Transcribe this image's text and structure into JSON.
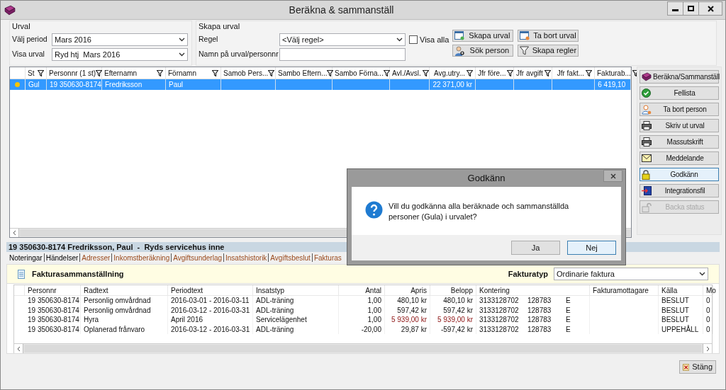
{
  "window": {
    "title": "Beräkna & sammanställ"
  },
  "urval": {
    "title": "Urval",
    "fields": [
      {
        "label": "Välj period",
        "value": "Mars 2016"
      },
      {
        "label": "Visa urval",
        "value": "Ryd htj  Mars 2016"
      }
    ]
  },
  "skapa_urval": {
    "title": "Skapa urval",
    "regel": {
      "label": "Regel",
      "value": "<Välj regel>"
    },
    "namn": {
      "label": "Namn på urval/personnr"
    },
    "visa_alla": {
      "label": "Visa alla",
      "checked": false
    },
    "buttons": [
      {
        "label": "Skapa urval"
      },
      {
        "label": "Ta bort urval"
      },
      {
        "label": "Sök person"
      },
      {
        "label": "Skapa regler"
      }
    ]
  },
  "grid": {
    "columns": [
      {
        "label": "St"
      },
      {
        "label": "Personnr (1 st)"
      },
      {
        "label": "Efternamn"
      },
      {
        "label": "Förnamn"
      },
      {
        "label": "Samob Pers..."
      },
      {
        "label": "Sambo Eftern..."
      },
      {
        "label": "Sambo Förna..."
      },
      {
        "label": "Avl./Avsl."
      },
      {
        "label": "Avg.utry..."
      },
      {
        "label": "Jfr före..."
      },
      {
        "label": "Jfr avgift"
      },
      {
        "label": "Jfr fakt..."
      },
      {
        "label": "Fakturab..."
      }
    ],
    "rows": [
      {
        "selected": true,
        "color": "#f5c400",
        "cells": [
          "Gul",
          "19 350630-8174",
          "Fredriksson",
          "Paul",
          "",
          "",
          "",
          "",
          "22 371,00 kr",
          "",
          "",
          "",
          "6 419,10 "
        ]
      }
    ]
  },
  "side_buttons": [
    {
      "label": "Beräkna/Sammanställ",
      "disabled": false,
      "focused": false
    },
    {
      "label": "Fellista",
      "disabled": false,
      "focused": false
    },
    {
      "label": "Ta bort person",
      "disabled": false,
      "focused": false
    },
    {
      "label": "Skriv ut urval",
      "disabled": false,
      "focused": false
    },
    {
      "label": "Massutskrift",
      "disabled": false,
      "focused": false
    },
    {
      "label": "Meddelande",
      "disabled": false,
      "focused": false
    },
    {
      "label": "Godkänn",
      "disabled": false,
      "focused": true
    },
    {
      "label": "Integrationsfil",
      "disabled": false,
      "focused": false
    },
    {
      "label": "Backa status",
      "disabled": true,
      "focused": false
    }
  ],
  "detail": {
    "header": "19 350630-8174 Fredriksson, Paul  -  Ryds servicehus inne",
    "tabs": [
      {
        "label": "Noteringar",
        "kind": "plain"
      },
      {
        "label": "Händelser",
        "kind": "plain"
      },
      {
        "label": "Adresser",
        "kind": "link"
      },
      {
        "label": "Inkomstberäkning",
        "kind": "link"
      },
      {
        "label": "Avgiftsunderlag",
        "kind": "link"
      },
      {
        "label": "Insatshistorik",
        "kind": "link"
      },
      {
        "label": "Avgiftsbeslut",
        "kind": "link"
      },
      {
        "label": "Fakturas",
        "kind": "link"
      }
    ],
    "panel": {
      "title": "Fakturasammanställning",
      "fakturatyp": {
        "label": "Fakturatyp",
        "value": "Ordinarie faktura"
      },
      "columns": [
        {
          "label": "Personnr"
        },
        {
          "label": "Radtext"
        },
        {
          "label": "Periodtext"
        },
        {
          "label": "Insatstyp"
        },
        {
          "label": "Antal"
        },
        {
          "label": "Apris"
        },
        {
          "label": "Belopp"
        },
        {
          "label": "Kontering"
        },
        {
          "label": "Fakturamottagare"
        },
        {
          "label": "Källa"
        },
        {
          "label": "Mo"
        }
      ],
      "rows": [
        {
          "warning": false,
          "personnr": "19 350630-8174",
          "radtext": "Personlig omvårdnad",
          "periodtext": "2016-03-01 - 2016-03-11",
          "insatstyp": "ADL-träning",
          "antal": "1,00",
          "apris": "480,10 kr",
          "belopp": "480,10 kr",
          "kontering": [
            "3133128702",
            "128783",
            "E"
          ],
          "kalla": "BESLUT",
          "mo": "0"
        },
        {
          "warning": false,
          "personnr": "19 350630-8174",
          "radtext": "Personlig omvårdnad",
          "periodtext": "2016-03-12 - 2016-03-31",
          "insatstyp": "ADL-träning",
          "antal": "1,00",
          "apris": "597,42 kr",
          "belopp": "597,42 kr",
          "kontering": [
            "3133128702",
            "128783",
            "E"
          ],
          "kalla": "BESLUT",
          "mo": "0"
        },
        {
          "warning": true,
          "personnr": "19 350630-8174",
          "radtext": "Hyra",
          "periodtext": "April 2016",
          "insatstyp": "Servicelägenhet",
          "antal": "1,00",
          "apris": "5 939,00 kr",
          "belopp": "5 939,00 kr",
          "kontering": [
            "3133128702",
            "128783",
            "E"
          ],
          "kalla": "BESLUT",
          "mo": "0"
        },
        {
          "warning": false,
          "personnr": "19 350630-8174",
          "radtext": "Oplanerad frånvaro",
          "periodtext": "2016-03-12 - 2016-03-31",
          "insatstyp": "ADL-träning",
          "antal": "-20,00",
          "apris": "29,87 kr",
          "belopp": "-597,42 kr",
          "kontering": [
            "3133128702",
            "128783",
            "E"
          ],
          "kalla": "UPPEHÅLL",
          "mo": "0"
        }
      ]
    }
  },
  "dialog": {
    "title": "Godkänn",
    "message": "Vill du godkänna alla beräknade och sammanställda personer (Gula) i urvalet?",
    "buttons": [
      {
        "label": "Ja",
        "focused": false
      },
      {
        "label": "Nej",
        "focused": true
      }
    ]
  },
  "close_button": {
    "label": "Stäng"
  }
}
